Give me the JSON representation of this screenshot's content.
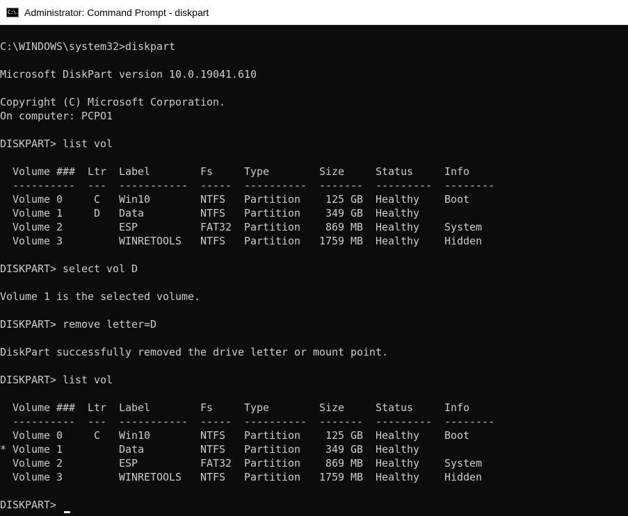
{
  "window": {
    "title": "Administrator: Command Prompt - diskpart",
    "icon": "cmd-icon",
    "icon_text": "C:\\."
  },
  "console": {
    "lines": [
      "C:\\WINDOWS\\system32>diskpart",
      "",
      "Microsoft DiskPart version 10.0.19041.610",
      "",
      "Copyright (C) Microsoft Corporation.",
      "On computer: PCPO1",
      "",
      "DISKPART> list vol",
      "",
      "  Volume ###  Ltr  Label        Fs     Type        Size     Status     Info",
      "  ----------  ---  -----------  -----  ----------  -------  ---------  --------",
      "  Volume 0     C   Win10        NTFS   Partition    125 GB  Healthy    Boot",
      "  Volume 1     D   Data         NTFS   Partition    349 GB  Healthy",
      "  Volume 2         ESP          FAT32  Partition    869 MB  Healthy    System",
      "  Volume 3         WINRETOOLS   NTFS   Partition   1759 MB  Healthy    Hidden",
      "",
      "DISKPART> select vol D",
      "",
      "Volume 1 is the selected volume.",
      "",
      "DISKPART> remove letter=D",
      "",
      "DiskPart successfully removed the drive letter or mount point.",
      "",
      "DISKPART> list vol",
      "",
      "  Volume ###  Ltr  Label        Fs     Type        Size     Status     Info",
      "  ----------  ---  -----------  -----  ----------  -------  ---------  --------",
      "  Volume 0     C   Win10        NTFS   Partition    125 GB  Healthy    Boot",
      "* Volume 1         Data         NTFS   Partition    349 GB  Healthy",
      "  Volume 2         ESP          FAT32  Partition    869 MB  Healthy    System",
      "  Volume 3         WINRETOOLS   NTFS   Partition   1759 MB  Healthy    Hidden",
      ""
    ],
    "prompt": "DISKPART> "
  },
  "colors": {
    "background": "#0c0c0c",
    "text": "#cccccc",
    "titlebar": "#ffffff"
  }
}
